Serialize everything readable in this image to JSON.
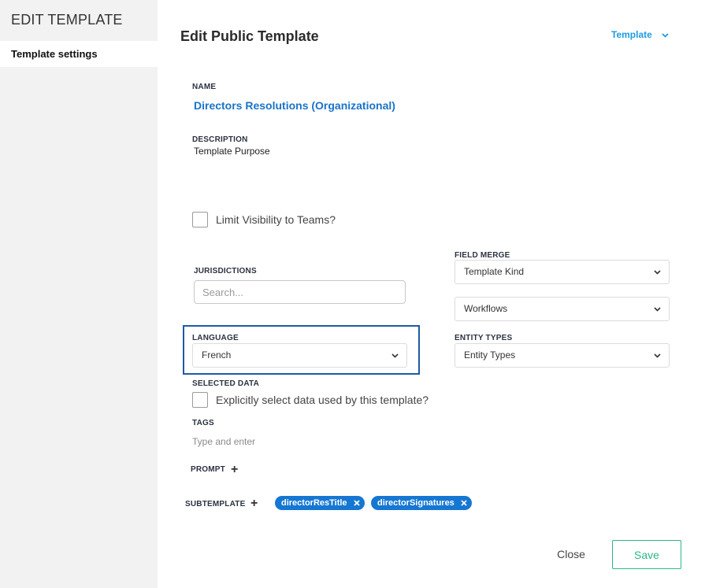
{
  "sidebar": {
    "title": "EDIT TEMPLATE",
    "items": [
      {
        "label": "Template settings"
      }
    ]
  },
  "header": {
    "title": "Edit Public Template",
    "menu_label": "Template"
  },
  "name": {
    "label": "NAME",
    "value": "Directors Resolutions (Organizational)"
  },
  "description": {
    "label": "DESCRIPTION",
    "value": "Template Purpose"
  },
  "limit_visibility": {
    "label": "Limit Visibility to Teams?",
    "checked": false
  },
  "jurisdictions": {
    "label": "JURISDICTIONS",
    "placeholder": "Search..."
  },
  "field_merge": {
    "label": "FIELD MERGE",
    "template_kind": "Template Kind",
    "workflows": "Workflows"
  },
  "language": {
    "label": "LANGUAGE",
    "value": "French"
  },
  "entity_types": {
    "label": "ENTITY TYPES",
    "value": "Entity Types"
  },
  "selected_data": {
    "label": "SELECTED DATA",
    "checkbox_label": "Explicitly select data used by this template?",
    "checked": false
  },
  "tags": {
    "label": "TAGS",
    "placeholder": "Type and enter"
  },
  "prompt": {
    "label": "PROMPT"
  },
  "subtemplate": {
    "label": "SUBTEMPLATE",
    "chips": [
      {
        "label": "directorResTitle"
      },
      {
        "label": "directorSignatures"
      }
    ]
  },
  "footer": {
    "close_label": "Close",
    "save_label": "Save"
  },
  "colors": {
    "accent": "#1e9be0",
    "link": "#1a73c9",
    "chip": "#1677d2",
    "save": "#2fb58a",
    "focus_border": "#1f5aa6"
  }
}
